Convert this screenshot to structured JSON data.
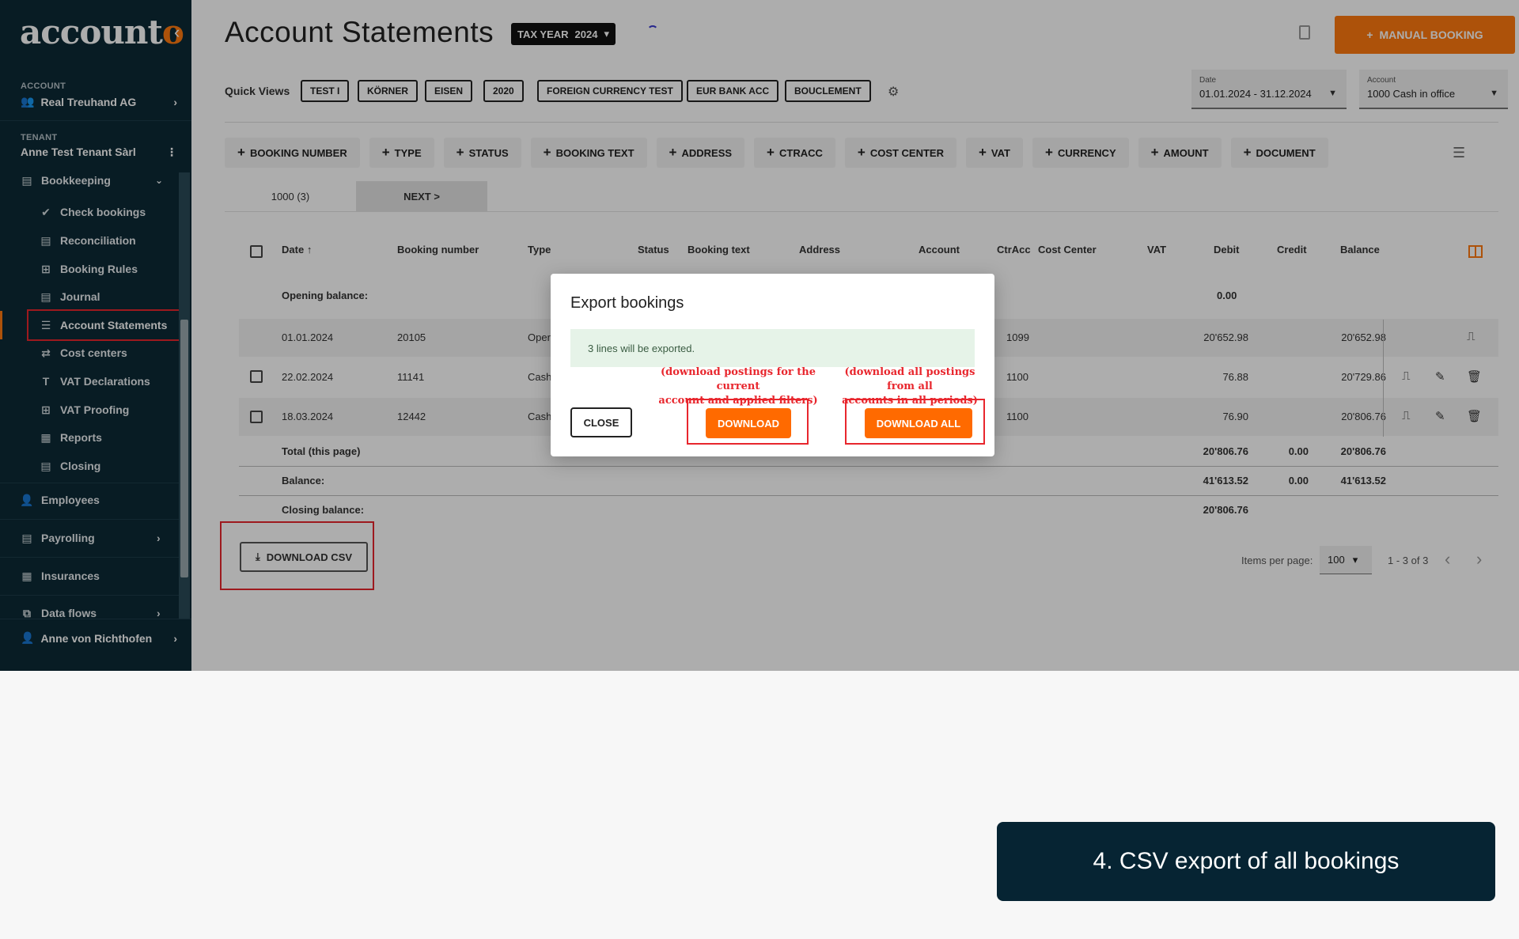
{
  "sidebar": {
    "logo_main": "account",
    "logo_accent": "o",
    "account_label": "ACCOUNT",
    "account_name": "Real Treuhand AG",
    "tenant_label": "TENANT",
    "tenant_name": "Anne Test Tenant Sàrl",
    "group_label": "Bookkeeping",
    "items": [
      {
        "label": "Check bookings",
        "icon": "double-check-icon"
      },
      {
        "label": "Reconciliation",
        "icon": "card-icon"
      },
      {
        "label": "Booking Rules",
        "icon": "table-icon"
      },
      {
        "label": "Journal",
        "icon": "card-icon"
      },
      {
        "label": "Account Statements",
        "icon": "lines-icon"
      },
      {
        "label": "Cost centers",
        "icon": "swap-icon"
      },
      {
        "label": "VAT Declarations",
        "icon": "text-icon"
      },
      {
        "label": "VAT Proofing",
        "icon": "table-icon"
      },
      {
        "label": "Reports",
        "icon": "document-icon"
      },
      {
        "label": "Closing",
        "icon": "card-icon"
      }
    ],
    "sections": [
      "Employees",
      "Payrolling",
      "Insurances",
      "Data flows"
    ],
    "user_name": "Anne von Richthofen"
  },
  "header": {
    "title": "Account Statements",
    "tax_year_label": "TAX YEAR",
    "tax_year_value": "2024",
    "manual_booking": "MANUAL BOOKING"
  },
  "quick_views": {
    "label": "Quick Views",
    "chips": [
      "TEST I",
      "KÖRNER",
      "EISEN",
      "2020",
      "FOREIGN CURRENCY TEST",
      "EUR BANK ACC",
      "BOUCLEMENT"
    ]
  },
  "date_filter": {
    "label": "Date",
    "value": "01.01.2024 - 31.12.2024"
  },
  "account_filter": {
    "label": "Account",
    "value": "1000 Cash in office"
  },
  "filters": [
    "BOOKING NUMBER",
    "TYPE",
    "STATUS",
    "BOOKING TEXT",
    "ADDRESS",
    "CTRACC",
    "COST CENTER",
    "VAT",
    "CURRENCY",
    "AMOUNT",
    "DOCUMENT"
  ],
  "account_tabs": {
    "current": "1000 (3)",
    "next": "NEXT >"
  },
  "table": {
    "headers": {
      "date": "Date",
      "booking_number": "Booking number",
      "type": "Type",
      "status": "Status",
      "booking_text": "Booking text",
      "address": "Address",
      "account": "Account",
      "ctracc": "CtrAcc",
      "cost_center": "Cost Center",
      "vat": "VAT",
      "debit": "Debit",
      "credit": "Credit",
      "balance": "Balance"
    },
    "opening_label": "Opening balance:",
    "opening_value": "0.00",
    "rows": [
      {
        "date": "01.01.2024",
        "number": "20105",
        "type": "Oper",
        "ctracc": "1099",
        "debit": "20'652.98",
        "balance": "20'652.98"
      },
      {
        "date": "22.02.2024",
        "number": "11141",
        "type": "Cash",
        "ctracc": "1100",
        "debit": "76.88",
        "balance": "20'729.86"
      },
      {
        "date": "18.03.2024",
        "number": "12442",
        "type": "Cash",
        "ctracc": "1100",
        "debit": "76.90",
        "balance": "20'806.76"
      }
    ],
    "total_label": "Total (this page)",
    "total_debit": "20'806.76",
    "total_credit": "0.00",
    "total_balance": "20'806.76",
    "balance_label": "Balance:",
    "balance_debit": "41'613.52",
    "balance_credit": "0.00",
    "balance_balance": "41'613.52",
    "closing_label": "Closing balance:",
    "closing_debit": "20'806.76"
  },
  "footer": {
    "download_csv": "DOWNLOAD CSV",
    "items_per_page_label": "Items per page:",
    "items_per_page": "100",
    "pager": "1 - 3 of 3"
  },
  "dialog": {
    "title": "Export bookings",
    "info": "3 lines will be exported.",
    "close": "CLOSE",
    "download": "DOWNLOAD",
    "download_all": "DOWNLOAD ALL",
    "note_download_1": "(download postings for the current",
    "note_download_2": "account and applied filters)",
    "note_all_1": "(download all postings from all",
    "note_all_2": "accounts in all periods)"
  },
  "caption": "4. CSV export of all bookings",
  "colors": {
    "accent": "#ff7a10",
    "sidebar": "#0d2a36",
    "annotation": "#e8262d",
    "caption_bg": "#062433"
  }
}
